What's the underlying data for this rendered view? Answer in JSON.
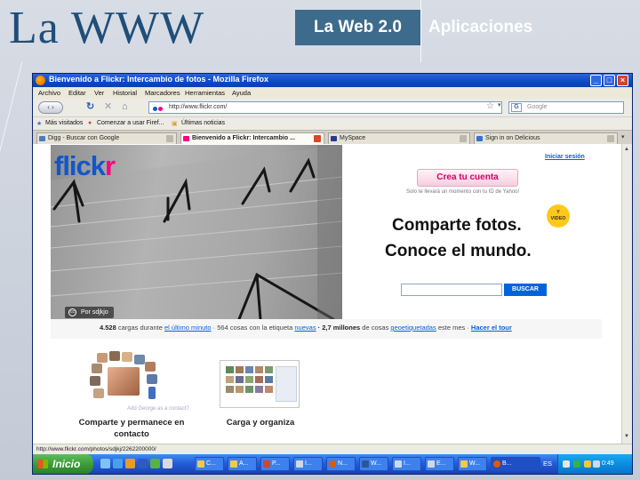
{
  "slide": {
    "title": "La WWW",
    "tab_active": "La Web 2.0",
    "tab_inactive": "Aplicaciones"
  },
  "window": {
    "title": "Bienvenido a Flickr: Intercambio de fotos - Mozilla Firefox",
    "menu": [
      "Archivo",
      "Editar",
      "Ver",
      "Historial",
      "Marcadores",
      "Herramientas",
      "Ayuda"
    ],
    "url": "http://www.flickr.com/",
    "search_placeholder": "Google",
    "bookmarks": [
      "Más visitados",
      "Comenzar a usar Firef...",
      "Últimas noticias"
    ],
    "tabs": [
      {
        "label": "Digg - Buscar con Google",
        "active": false
      },
      {
        "label": "Bienvenido a Flickr: Intercambio ...",
        "active": true
      },
      {
        "label": "MySpace",
        "active": false
      },
      {
        "label": "Sign in on Delicious",
        "active": false
      }
    ],
    "status": "http://www.flickr.com/photos/sdjkj/2262200000/"
  },
  "page": {
    "logo_a": "flick",
    "logo_b": "r",
    "photo_credit": "Por sdjkjo",
    "login_link": "Iniciar sesión",
    "signup_button": "Crea tu cuenta",
    "signup_note": "Solo te llevará un momento con tu ID de Yahoo!",
    "badge": [
      "Y",
      "VIDEO"
    ],
    "headline_1": "Comparte fotos.",
    "headline_2": "Conoce el mundo.",
    "search_button": "BUSCAR",
    "stats": {
      "uploads": "4.528",
      "uploads_text": "cargas durante",
      "last_minute": "el último minuto",
      "tagged": "· 564 cosas con la etiqueta",
      "new": "nuevas",
      "millions": "· 2,7 millones",
      "geotagged_text": "de cosas",
      "geotagged": "geoetiquetadas",
      "geotagged_tail": "este mes ·",
      "tour": "Hacer el tour"
    },
    "feature_1_hint": "Add George as a contact?",
    "feature_1": "Comparte y permanece en contacto",
    "feature_2": "Carga y organiza"
  },
  "taskbar": {
    "start": "Inicio",
    "buttons": [
      "C...",
      "A...",
      "P...",
      "I...",
      "N...",
      "W...",
      "I...",
      "E...",
      "W...",
      "B..."
    ],
    "active_index": 9,
    "language": "ES",
    "clock": "0:49"
  },
  "colors": {
    "slide_title": "#1f4e79",
    "slide_tab": "#3d6b8c",
    "flickr_blue": "#1057c9",
    "flickr_pink": "#ff0084",
    "xp_blue": "#245edb",
    "start_green": "#3a9a36"
  }
}
